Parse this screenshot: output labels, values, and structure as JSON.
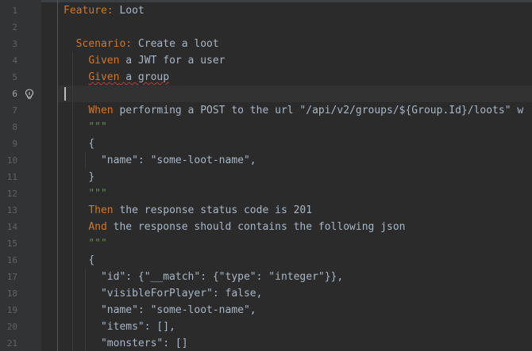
{
  "editor": {
    "active_line": 6,
    "lines": [
      {
        "n": "1",
        "indent": "",
        "segs": [
          {
            "t": "Feature:",
            "c": "kw"
          },
          {
            "t": " Loot",
            "c": "plain"
          }
        ]
      },
      {
        "n": "2",
        "indent": "",
        "segs": []
      },
      {
        "n": "3",
        "indent": "  ",
        "segs": [
          {
            "t": "Scenario:",
            "c": "kw"
          },
          {
            "t": " Create a loot",
            "c": "plain"
          }
        ]
      },
      {
        "n": "4",
        "indent": "    ",
        "segs": [
          {
            "t": "Given",
            "c": "kw"
          },
          {
            "t": " a JWT for a user",
            "c": "plain"
          }
        ]
      },
      {
        "n": "5",
        "indent": "    ",
        "segs": [
          {
            "t": "Given",
            "c": "kw",
            "squiggle": true
          },
          {
            "t": " a group",
            "c": "plain",
            "squiggle": true
          }
        ]
      },
      {
        "n": "6",
        "indent": "",
        "segs": []
      },
      {
        "n": "7",
        "indent": "    ",
        "segs": [
          {
            "t": "When",
            "c": "kw"
          },
          {
            "t": " performing a POST to the url \"/api/v2/groups/${Group.Id}/loots\" w",
            "c": "plain"
          }
        ]
      },
      {
        "n": "8",
        "indent": "    ",
        "segs": [
          {
            "t": "\"\"\"",
            "c": "str"
          }
        ]
      },
      {
        "n": "9",
        "indent": "    ",
        "segs": [
          {
            "t": "{",
            "c": "plain"
          }
        ]
      },
      {
        "n": "10",
        "indent": "      ",
        "segs": [
          {
            "t": "\"name\": \"some-loot-name\",",
            "c": "plain"
          }
        ]
      },
      {
        "n": "11",
        "indent": "    ",
        "segs": [
          {
            "t": "}",
            "c": "plain"
          }
        ]
      },
      {
        "n": "12",
        "indent": "    ",
        "segs": [
          {
            "t": "\"\"\"",
            "c": "str"
          }
        ]
      },
      {
        "n": "13",
        "indent": "    ",
        "segs": [
          {
            "t": "Then",
            "c": "kw"
          },
          {
            "t": " the response status code is 201",
            "c": "plain"
          }
        ]
      },
      {
        "n": "14",
        "indent": "    ",
        "segs": [
          {
            "t": "And",
            "c": "kw"
          },
          {
            "t": " the response should contains the following json",
            "c": "plain"
          }
        ]
      },
      {
        "n": "15",
        "indent": "    ",
        "segs": [
          {
            "t": "\"\"\"",
            "c": "str"
          }
        ]
      },
      {
        "n": "16",
        "indent": "    ",
        "segs": [
          {
            "t": "{",
            "c": "plain"
          }
        ]
      },
      {
        "n": "17",
        "indent": "      ",
        "segs": [
          {
            "t": "\"id\": {\"__match\": {\"type\": \"integer\"}},",
            "c": "plain"
          }
        ]
      },
      {
        "n": "18",
        "indent": "      ",
        "segs": [
          {
            "t": "\"visibleForPlayer\": false,",
            "c": "plain"
          }
        ]
      },
      {
        "n": "19",
        "indent": "      ",
        "segs": [
          {
            "t": "\"name\": \"some-loot-name\",",
            "c": "plain"
          }
        ]
      },
      {
        "n": "20",
        "indent": "      ",
        "segs": [
          {
            "t": "\"items\": [],",
            "c": "plain"
          }
        ]
      },
      {
        "n": "21",
        "indent": "      ",
        "segs": [
          {
            "t": "\"monsters\": []",
            "c": "plain"
          }
        ]
      }
    ]
  },
  "gutter": {
    "intention_icon": "lightbulb-icon"
  },
  "colors": {
    "background": "#2b2b2b",
    "gutter": "#313335",
    "keyword": "#cc7832",
    "string": "#6a8759",
    "text": "#a9b7c6",
    "line_number": "#606366",
    "error_squiggle": "#bc3f3c"
  }
}
